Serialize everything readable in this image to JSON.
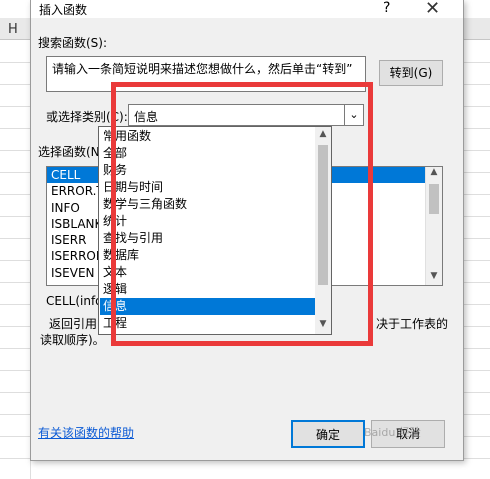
{
  "sheet": {
    "column_letter": "H"
  },
  "dialog": {
    "title": "插入函数",
    "help_glyph": "?",
    "close_glyph": "✕",
    "search_label": "搜索函数(S):",
    "search_value": "请输入一条简短说明来描述您想做什么，然后单击“转到”",
    "goto_button": "转到(G)",
    "category_label": "或选择类别(C):",
    "category_value": "信息",
    "select_function_label": "选择函数(N):",
    "functions": [
      "CELL",
      "ERROR.TYPE",
      "INFO",
      "ISBLANK",
      "ISERR",
      "ISERROR",
      "ISEVEN"
    ],
    "selected_function_index": 0,
    "signature": "CELL(info_type,",
    "description_line1_left": "返回引用中第一",
    "description_line1_right": "决于工作表的",
    "description_line2": "读取顺序)。",
    "help_link": "有关该函数的帮助",
    "ok_button": "确定",
    "cancel_button": "取消"
  },
  "dropdown": {
    "items": [
      "常用函数",
      "全部",
      "财务",
      "日期与时间",
      "数学与三角函数",
      "统计",
      "查找与引用",
      "数据库",
      "文本",
      "逻辑",
      "信息",
      "工程"
    ],
    "selected_index": 10
  },
  "colors": {
    "highlight": "#0078d7",
    "annotation_box": "#ea3a3a",
    "link": "#0b5ad5"
  },
  "watermark_text": "Baidu 经验"
}
